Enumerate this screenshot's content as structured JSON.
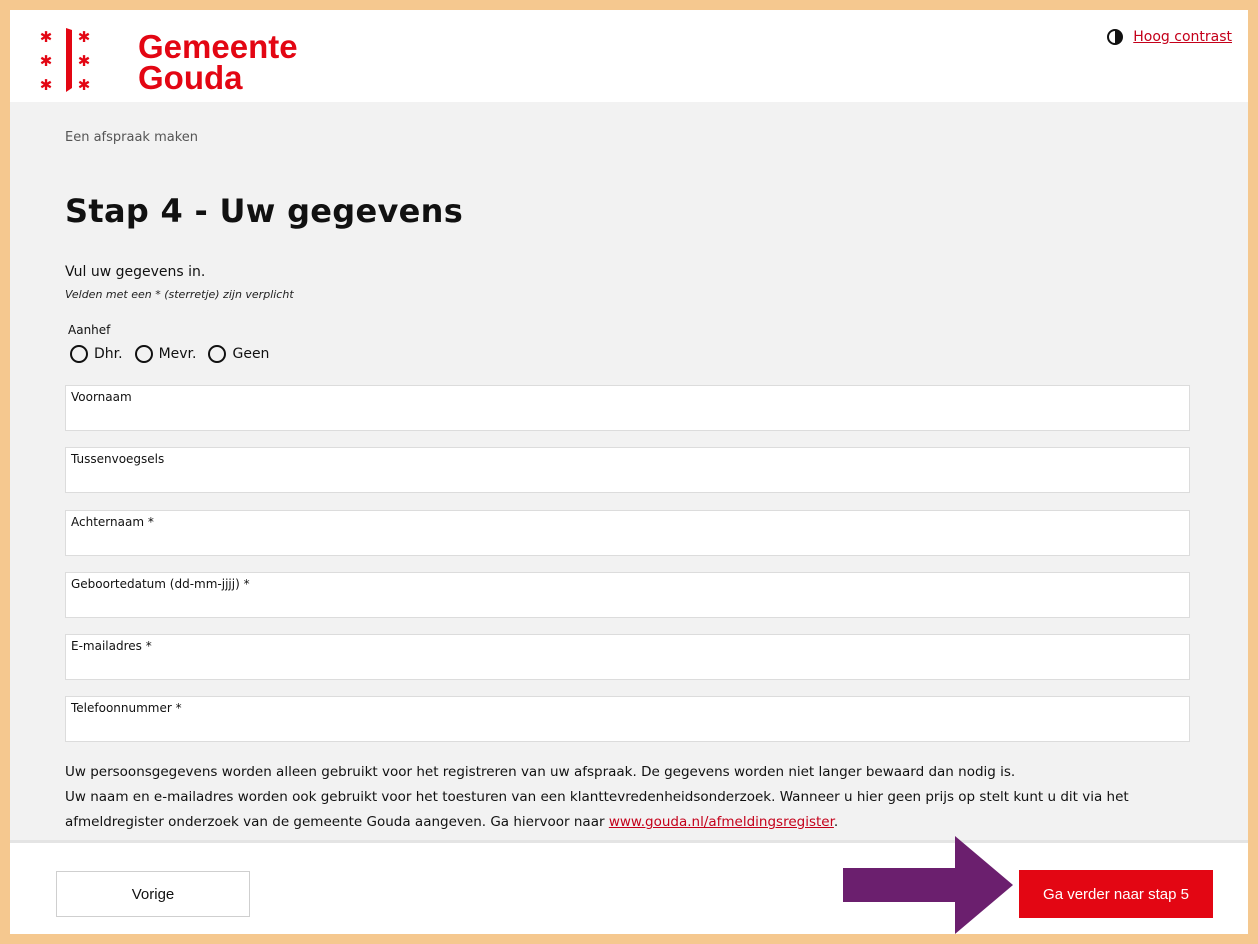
{
  "header": {
    "logo_line1": "Gemeente",
    "logo_line2": "Gouda",
    "contrast_link": "Hoog contrast"
  },
  "breadcrumb": "Een afspraak maken",
  "title": "Stap 4 - Uw gegevens",
  "intro": "Vul uw gegevens in.",
  "required_note": "Velden met een * (sterretje) zijn verplicht",
  "aanhef": {
    "label": "Aanhef",
    "options": [
      "Dhr.",
      "Mevr.",
      "Geen"
    ]
  },
  "fields": [
    {
      "label": "Voornaam",
      "value": ""
    },
    {
      "label": "Tussenvoegsels",
      "value": ""
    },
    {
      "label": "Achternaam *",
      "value": ""
    },
    {
      "label": "Geboortedatum (dd-mm-jjjj) *",
      "value": ""
    },
    {
      "label": "E-mailadres *",
      "value": ""
    },
    {
      "label": "Telefoonnummer *",
      "value": ""
    }
  ],
  "privacy": {
    "line1": "Uw persoonsgegevens worden alleen gebruikt voor het registreren van uw afspraak. De gegevens worden niet langer bewaard dan nodig is.",
    "line2": "Uw naam en e-mailadres worden ook gebruikt voor het toesturen van een klanttevredenheidsonderzoek. Wanneer u hier geen prijs op stelt kunt u dit via het afmeldregister onderzoek van de gemeente Gouda aangeven. Ga hiervoor naar ",
    "link": "www.gouda.nl/afmeldingsregister",
    "after_link": "."
  },
  "footer": {
    "prev_label": "Vorige",
    "next_label": "Ga verder naar stap 5"
  },
  "colors": {
    "brand_red": "#e30613",
    "arrow_purple": "#6b1f6e",
    "page_border": "#f5c88f"
  },
  "icons": [
    "gouda-logo-icon",
    "contrast-icon",
    "arrow-right-icon"
  ]
}
